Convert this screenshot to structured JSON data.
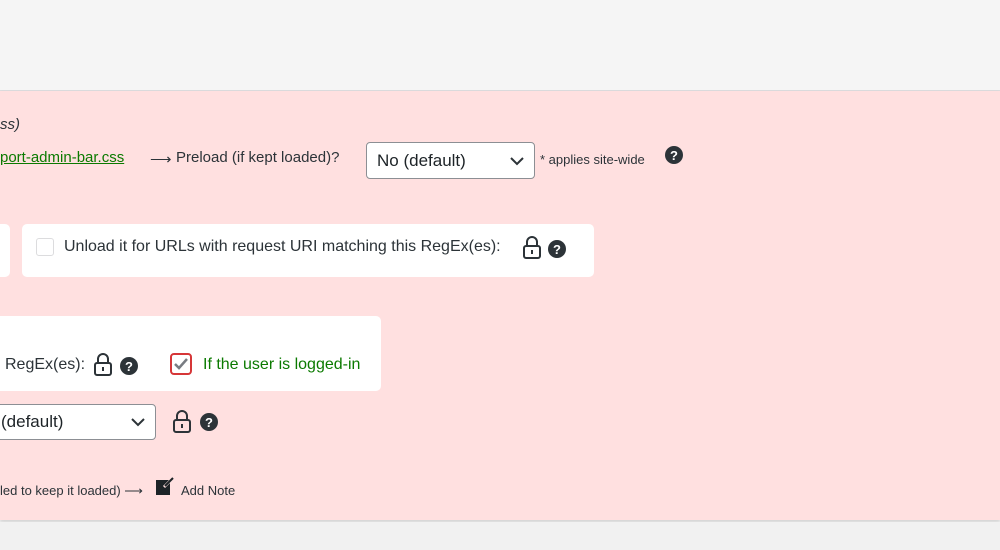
{
  "section": {
    "italic_text": "ss)",
    "file_link": "port-admin-bar.css",
    "arrow": "⟶",
    "preload_label": "Preload (if kept loaded)?",
    "preload_value": "No (default)",
    "applies_note": "* applies site-wide"
  },
  "unload_regex": {
    "label": "Unload it for URLs with request URI matching this RegEx(es):"
  },
  "load_exceptions": {
    "regex_label": "RegEx(es):",
    "logged_in_label": "If the user is logged-in"
  },
  "dropdown2": {
    "value": "(default)"
  },
  "note_row": {
    "text": "led to keep it loaded) ⟶",
    "add_note_label": "Add Note"
  },
  "colors": {
    "panel_bg": "#ffe0e0",
    "link_green": "#0b7a00",
    "checkbox_red": "#d63638"
  }
}
